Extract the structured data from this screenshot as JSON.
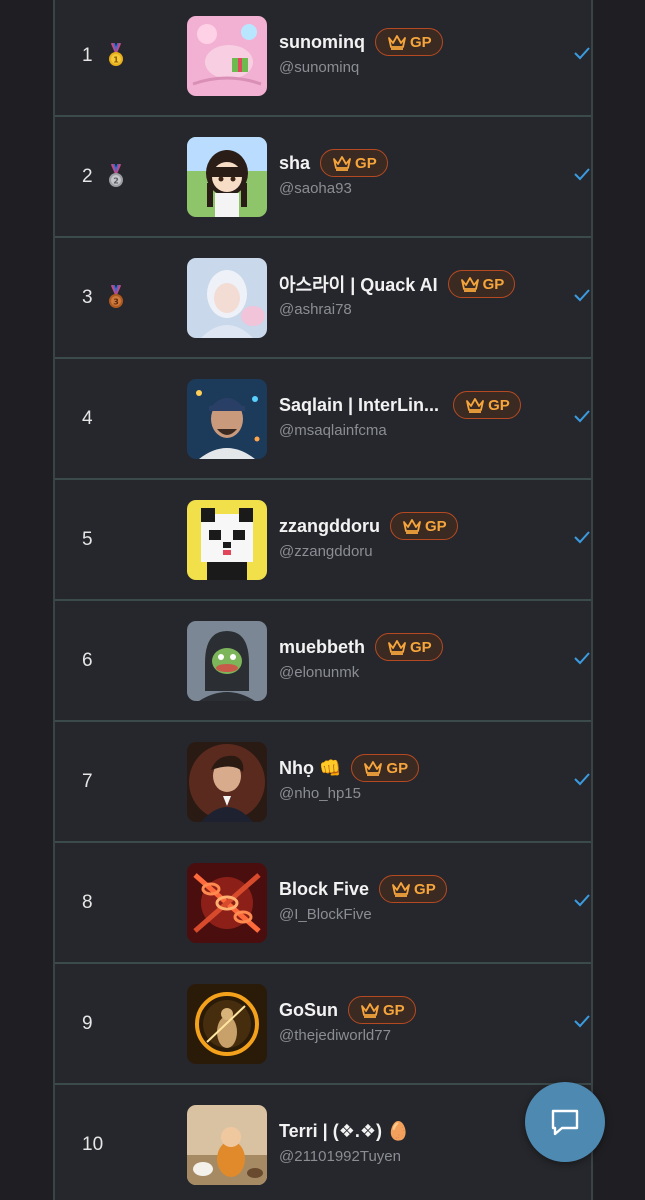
{
  "badge_label": "GP",
  "colors": {
    "badge_text": "#f6a53c",
    "badge_border": "#b54a22",
    "check": "#3b9be0",
    "fab": "#4e89b2"
  },
  "rows": [
    {
      "rank": "1",
      "medal": "gold",
      "name": "sunominq",
      "handle": "@sunominq",
      "verified": true
    },
    {
      "rank": "2",
      "medal": "silver",
      "name": "sha",
      "handle": "@saoha93",
      "verified": true
    },
    {
      "rank": "3",
      "medal": "bronze",
      "name": "아스라이 | Quack AI",
      "handle": "@ashrai78",
      "verified": true
    },
    {
      "rank": "4",
      "medal": "",
      "name": "Saqlain | InterLin...",
      "handle": "@msaqlainfcma",
      "verified": true
    },
    {
      "rank": "5",
      "medal": "",
      "name": "zzangddoru",
      "handle": "@zzangddoru",
      "verified": true
    },
    {
      "rank": "6",
      "medal": "",
      "name": "muebbeth",
      "handle": "@elonunmk",
      "verified": true
    },
    {
      "rank": "7",
      "medal": "",
      "name": "Nhọ 👊",
      "handle": "@nho_hp15",
      "verified": true
    },
    {
      "rank": "8",
      "medal": "",
      "name": "Block Five",
      "handle": "@I_BlockFive",
      "verified": true
    },
    {
      "rank": "9",
      "medal": "",
      "name": "GoSun",
      "handle": "@thejediworld77",
      "verified": true
    },
    {
      "rank": "10",
      "medal": "",
      "name": "Terri | (❖.❖) 🥚",
      "handle": "@21101992Tuyen",
      "verified": false
    }
  ],
  "fab": {
    "icon": "chat-bubble-icon"
  }
}
